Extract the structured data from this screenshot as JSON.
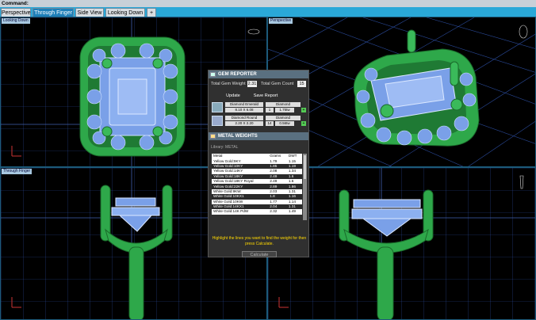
{
  "command_bar": {
    "label": "Command:"
  },
  "tabs": [
    {
      "label": "Perspective",
      "active": false
    },
    {
      "label": "Through Finger",
      "active": true
    },
    {
      "label": "Side View",
      "active": false
    },
    {
      "label": "Looking Down",
      "active": false
    },
    {
      "label": "+",
      "active": false
    }
  ],
  "viewports": {
    "top_left": {
      "label": "Looking Down"
    },
    "top_right": {
      "label": "Perspective"
    },
    "bottom_left": {
      "label": "Through Finger"
    },
    "bottom_right": {
      "label": ""
    }
  },
  "gem_reporter": {
    "title": "GEM REPORTER",
    "total_weight_label": "Total Gem Weight",
    "total_weight_value": "2.31",
    "total_count_label": "Total Gem Count",
    "total_count_value": "15",
    "update_label": "Update",
    "save_report_label": "Save Report",
    "gems": [
      {
        "name": "Diamond Emerald",
        "size": "8.10 X 6.08",
        "count": "1",
        "weight": "1.75tw",
        "material": "Diamond"
      },
      {
        "name": "Diamond Round",
        "size": "2.20 X 2.20",
        "count": "14",
        "weight": "0.56tw",
        "material": "Diamond"
      }
    ]
  },
  "metal_weights": {
    "title": "METAL WEIGHTS",
    "library_label": "Library: METAL",
    "columns": [
      "Metal",
      "Grams",
      "DWT"
    ],
    "rows": [
      {
        "metal": "Yellow Gold:9KY",
        "grams": "1.79",
        "dwt": "1.15"
      },
      {
        "metal": "Yellow Gold:10KY",
        "grams": "1.85",
        "dwt": "1.19"
      },
      {
        "metal": "Yellow Gold:14KY",
        "grams": "2.08",
        "dwt": "1.34"
      },
      {
        "metal": "Yellow Gold:18KY",
        "grams": "2.49",
        "dwt": "1.6"
      },
      {
        "metal": "Yellow Gold:18KY Royal",
        "grams": "2.49",
        "dwt": "1.6"
      },
      {
        "metal": "Yellow Gold:22KY",
        "grams": "2.89",
        "dwt": "1.86"
      },
      {
        "metal": "White Gold:9KW",
        "grams": "2.03",
        "dwt": "1.31"
      },
      {
        "metal": "White Gold:10KX1",
        "grams": "1.8",
        "dwt": "1.16"
      },
      {
        "metal": "White Gold:10KW",
        "grams": "1.77",
        "dwt": "1.14"
      },
      {
        "metal": "White Gold:14KX1",
        "grams": "2.04",
        "dwt": "1.31"
      },
      {
        "metal": "White Gold:14K PdW",
        "grams": "2.32",
        "dwt": "1.49"
      }
    ],
    "hint": "Highlight the lines you want to find the weight for then press Calculate.",
    "calculate_label": "Calculate"
  },
  "colors": {
    "metal_green": "#2ea84a",
    "gem_blue": "#7aa0e8",
    "grid": "#2a4a9a",
    "tab_bar": "#2aa8d8"
  }
}
